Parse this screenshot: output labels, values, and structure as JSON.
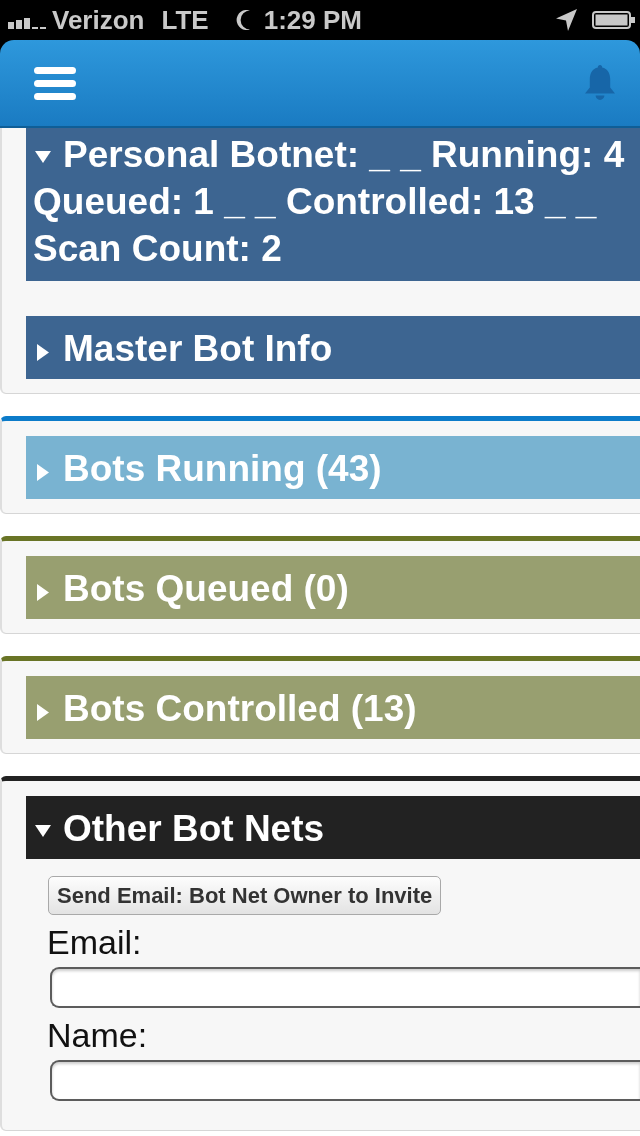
{
  "status_bar": {
    "carrier": "Verizon",
    "network": "LTE",
    "time": "1:29 PM"
  },
  "sections": [
    {
      "kind": "primary",
      "panels": [
        {
          "title_lines": [
            "Personal Botnet: _ _ Running: 4",
            "Queued: 1 _ _ Controlled: 13 _ _",
            "Scan Count: 2"
          ],
          "expanded": true
        },
        {
          "title_lines": [
            "Master Bot Info"
          ],
          "expanded": false
        }
      ]
    },
    {
      "kind": "info",
      "panels": [
        {
          "title_lines": [
            "Bots Running (43)"
          ],
          "expanded": false
        }
      ]
    },
    {
      "kind": "warning",
      "panels": [
        {
          "title_lines": [
            "Bots Queued (0)"
          ],
          "expanded": false
        }
      ]
    },
    {
      "kind": "warning",
      "panels": [
        {
          "title_lines": [
            "Bots Controlled (13)"
          ],
          "expanded": false
        }
      ]
    },
    {
      "kind": "dark",
      "panels": [
        {
          "title_lines": [
            "Other Bot Nets"
          ],
          "expanded": true,
          "form": {
            "button": "Send Email: Bot Net Owner to Invite",
            "fields": [
              {
                "label": "Email:"
              },
              {
                "label": "Name:"
              }
            ]
          }
        }
      ]
    }
  ]
}
